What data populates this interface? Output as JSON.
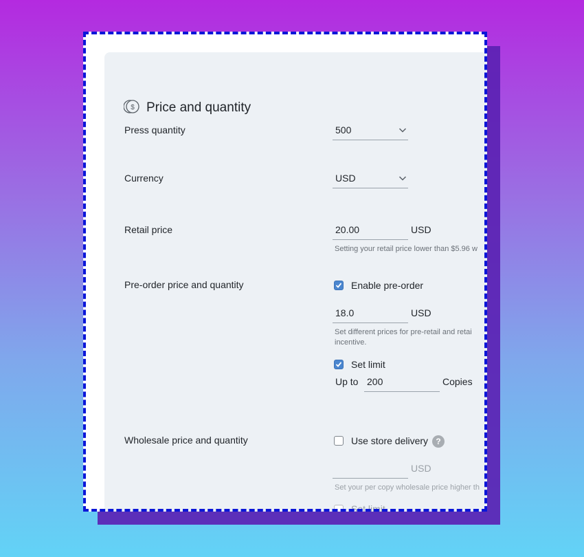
{
  "section": {
    "title": "Price and quantity",
    "icon": "coin-dollar-icon"
  },
  "press_quantity": {
    "label": "Press quantity",
    "value": "500"
  },
  "currency": {
    "label": "Currency",
    "value": "USD"
  },
  "retail_price": {
    "label": "Retail price",
    "value": "20.00",
    "unit": "USD",
    "hint": "Setting your retail price lower than $5.96 w"
  },
  "preorder": {
    "label": "Pre-order price and quantity",
    "enable_label": "Enable pre-order",
    "enable_checked": true,
    "price": "18.0",
    "unit": "USD",
    "hint_line1": "Set different prices for pre-retail and retai",
    "hint_line2": "incentive.",
    "set_limit_label": "Set limit",
    "set_limit_checked": true,
    "upto_label": "Up to",
    "limit_value": "200",
    "copies_label": "Copies"
  },
  "wholesale": {
    "label": "Wholesale price and quantity",
    "store_delivery_label": "Use store delivery",
    "store_delivery_checked": false,
    "help_icon": "?",
    "price": "",
    "unit": "USD",
    "hint": "Set your per copy wholesale price higher th",
    "set_limit_label": "Set limit"
  },
  "colors": {
    "accent": "#4a86cf",
    "panel": "#edf1f5",
    "dashed_border": "#0a16d8",
    "shadow": "#5b22b3"
  }
}
